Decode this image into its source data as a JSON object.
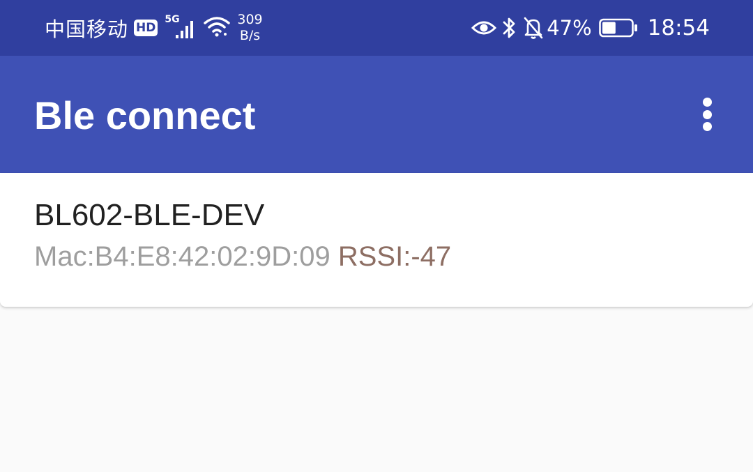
{
  "status_bar": {
    "carrier": "中国移动",
    "hd_badge": "HD",
    "network_type": "5G",
    "speed_value": "309",
    "speed_unit": "B/s",
    "battery_percent": "47%",
    "battery_level": 0.47,
    "time": "18:54",
    "icons": [
      "signal-icon",
      "wifi-icon",
      "eye-icon",
      "bluetooth-icon",
      "notifications-off-icon",
      "battery-icon"
    ]
  },
  "app_bar": {
    "title": "Ble connect",
    "menu_icon": "more-vert-icon"
  },
  "devices": [
    {
      "name": "BL602-BLE-DEV",
      "mac": "Mac:B4:E8:42:02:9D:09",
      "rssi": "RSSI:-47"
    }
  ],
  "colors": {
    "status_bar": "#303f9f",
    "app_bar": "#3f51b5",
    "background": "#fafafa",
    "mac_text": "#9e9e9e",
    "rssi_text": "#8d6e63"
  }
}
